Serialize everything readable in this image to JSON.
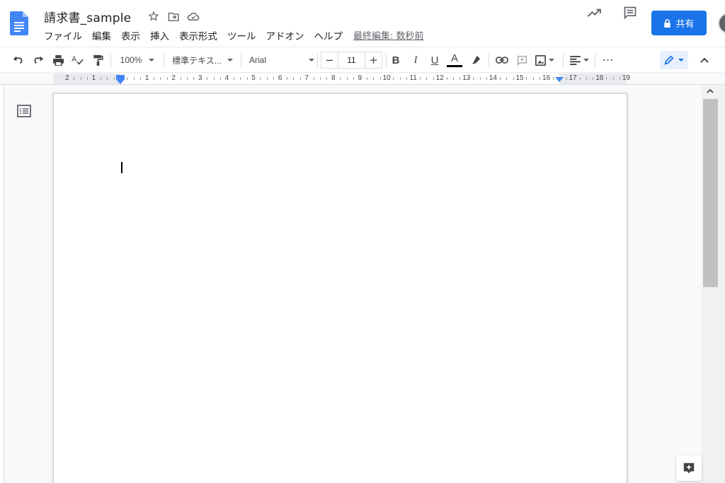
{
  "document": {
    "title": "請求書_sample",
    "last_edit": "最終編集: 数秒前"
  },
  "menu": {
    "items": [
      "ファイル",
      "編集",
      "表示",
      "挿入",
      "表示形式",
      "ツール",
      "アドオン",
      "ヘルプ"
    ]
  },
  "header": {
    "share_label": "共有"
  },
  "toolbar": {
    "zoom": "100%",
    "style": "標準テキス...",
    "font": "Arial",
    "font_size": "11",
    "minus": "−",
    "plus": "+",
    "bold": "B",
    "italic": "I",
    "underline": "U",
    "text_color": "A",
    "more": "⋯"
  },
  "ruler": {
    "labels_left": [
      "2",
      "1"
    ],
    "labels_right": [
      "1",
      "2",
      "3",
      "4",
      "5",
      "6",
      "7",
      "8",
      "9",
      "10",
      "11",
      "12",
      "13",
      "14",
      "15",
      "16",
      "17",
      "18",
      "19"
    ]
  },
  "colors": {
    "brand_blue": "#1a73e8",
    "docs_blue": "#4285f4",
    "accent_light": "#e8f0fe"
  },
  "icons": [
    "docs-logo-icon",
    "star-icon",
    "move-folder-icon",
    "cloud-saved-icon",
    "activity-trend-icon",
    "comment-icon",
    "lock-icon",
    "undo-icon",
    "redo-icon",
    "print-icon",
    "spellcheck-icon",
    "paint-format-icon",
    "highlighter-icon",
    "link-icon",
    "add-comment-icon",
    "insert-image-icon",
    "align-icon",
    "pencil-icon",
    "chevron-up-icon",
    "outline-icon",
    "explore-icon"
  ]
}
